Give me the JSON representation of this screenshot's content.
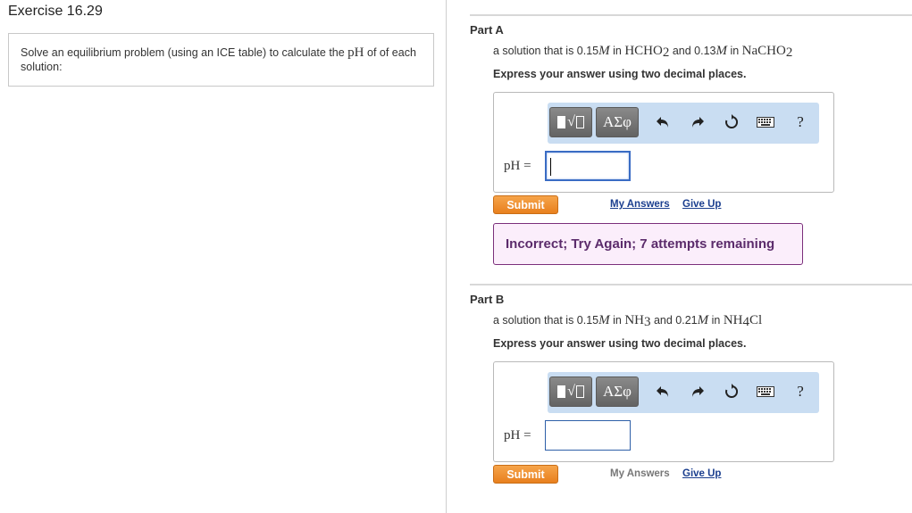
{
  "exercise": {
    "title": "Exercise 16.29",
    "problem_pre": "Solve an equilibrium problem (using an ICE table) to calculate the ",
    "problem_math": "pH",
    "problem_post": " of of each solution:"
  },
  "toolbar": {
    "greek_label": "ΑΣφ",
    "help_label": "?"
  },
  "parts": [
    {
      "title": "Part A",
      "q1": "a solution that is 0.15",
      "q1_unit": "M",
      "q1_mid": " in ",
      "q1_chem_a": "HCHO",
      "q1_chem_a_sub": "2",
      "q1_and": " and 0.13",
      "q1_unit2": "M",
      "q1_in2": " in ",
      "q1_chem_b": "NaCHO",
      "q1_chem_b_sub": "2",
      "instruction": "Express your answer using two decimal places.",
      "answer_label": "pH =",
      "answer_value": "",
      "submit_label": "Submit",
      "my_answers_label": "My Answers",
      "give_up_label": "Give Up",
      "feedback": "Incorrect; Try Again; 7 attempts remaining"
    },
    {
      "title": "Part B",
      "q1": "a solution that is 0.15",
      "q1_unit": "M",
      "q1_mid": " in ",
      "q1_chem_a": "NH",
      "q1_chem_a_sub": "3",
      "q1_and": " and 0.21",
      "q1_unit2": "M",
      "q1_in2": " in ",
      "q1_chem_b": "NH",
      "q1_chem_b_sub": "4",
      "q1_chem_b_tail": "Cl",
      "instruction": "Express your answer using two decimal places.",
      "answer_label": "pH =",
      "answer_value": "",
      "submit_label": "Submit",
      "my_answers_label": "My Answers",
      "give_up_label": "Give Up"
    }
  ]
}
